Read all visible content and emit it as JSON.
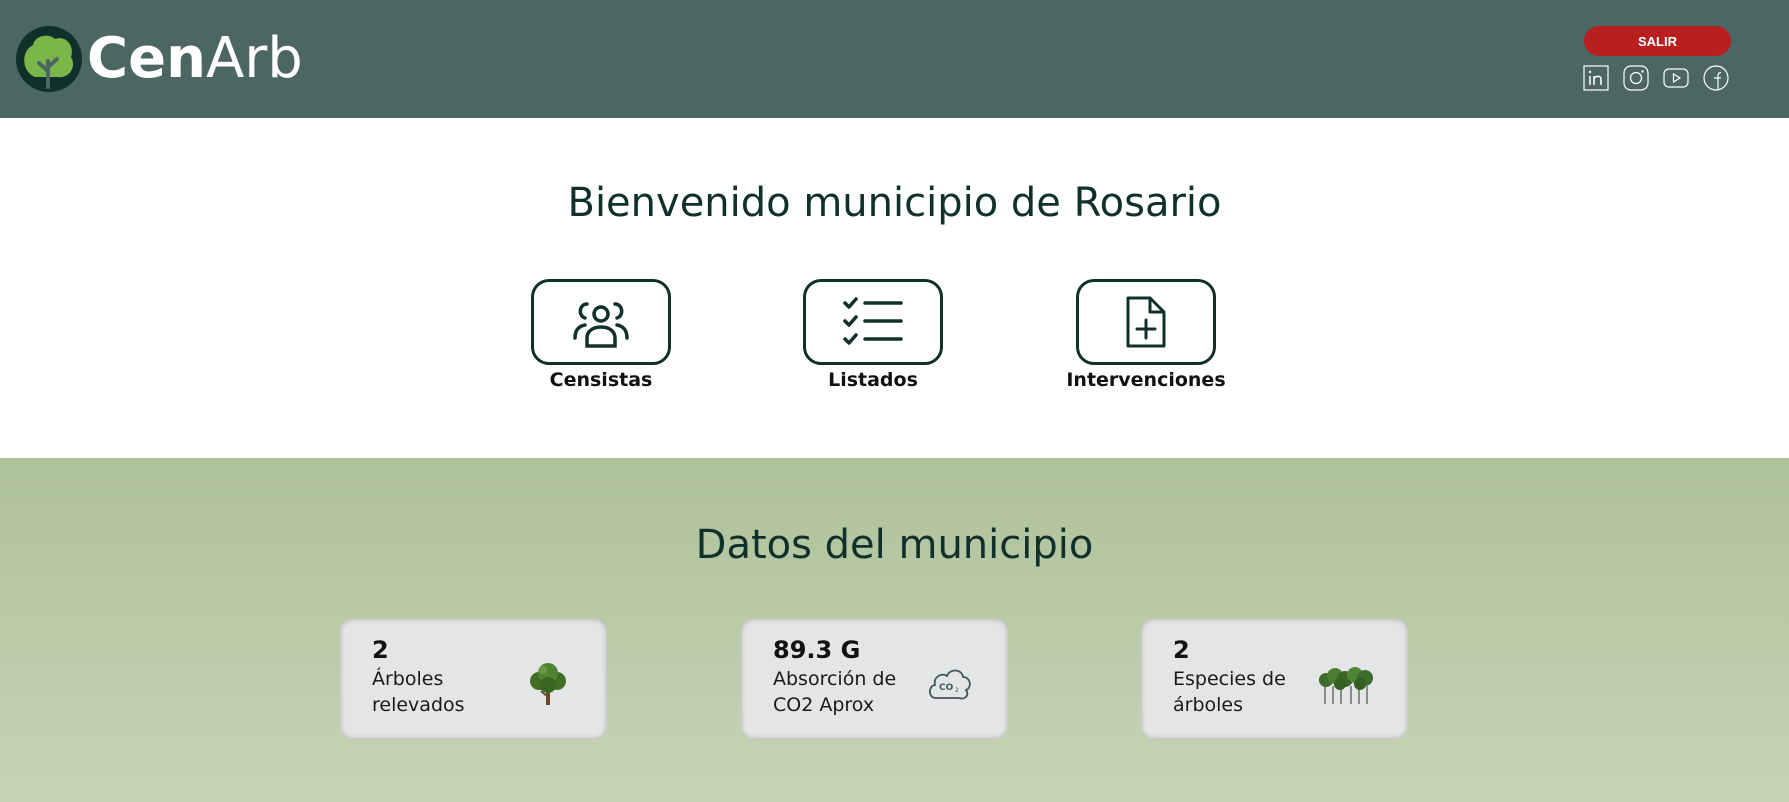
{
  "header": {
    "logo_text_bold": "Cen",
    "logo_text_light": "Arb",
    "logout_label": "SALIR",
    "socials": [
      "linkedin-icon",
      "instagram-icon",
      "youtube-icon",
      "facebook-icon"
    ]
  },
  "welcome": {
    "title": "Bienvenido municipio de Rosario",
    "actions": [
      {
        "label": "Censistas",
        "icon": "users-icon"
      },
      {
        "label": "Listados",
        "icon": "checklist-icon"
      },
      {
        "label": "Intervenciones",
        "icon": "add-document-icon"
      }
    ]
  },
  "datos": {
    "title": "Datos del municipio",
    "cards": [
      {
        "value": "2",
        "label": "Árboles relevados",
        "icon": "tree-icon"
      },
      {
        "value": "89.3 G",
        "label": "Absorción de CO2 Aprox",
        "icon": "co2-cloud-icon"
      },
      {
        "value": "2",
        "label": "Especies de árboles",
        "icon": "forest-icon"
      }
    ]
  },
  "colors": {
    "header_bg": "#4b6663",
    "logout_bg": "#b82020",
    "dark_green": "#10302c",
    "leaf_green": "#7ab648",
    "section_bg_top": "#aec29a",
    "section_bg_bottom": "#c6d4b6",
    "card_bg": "#e4e5e7"
  }
}
